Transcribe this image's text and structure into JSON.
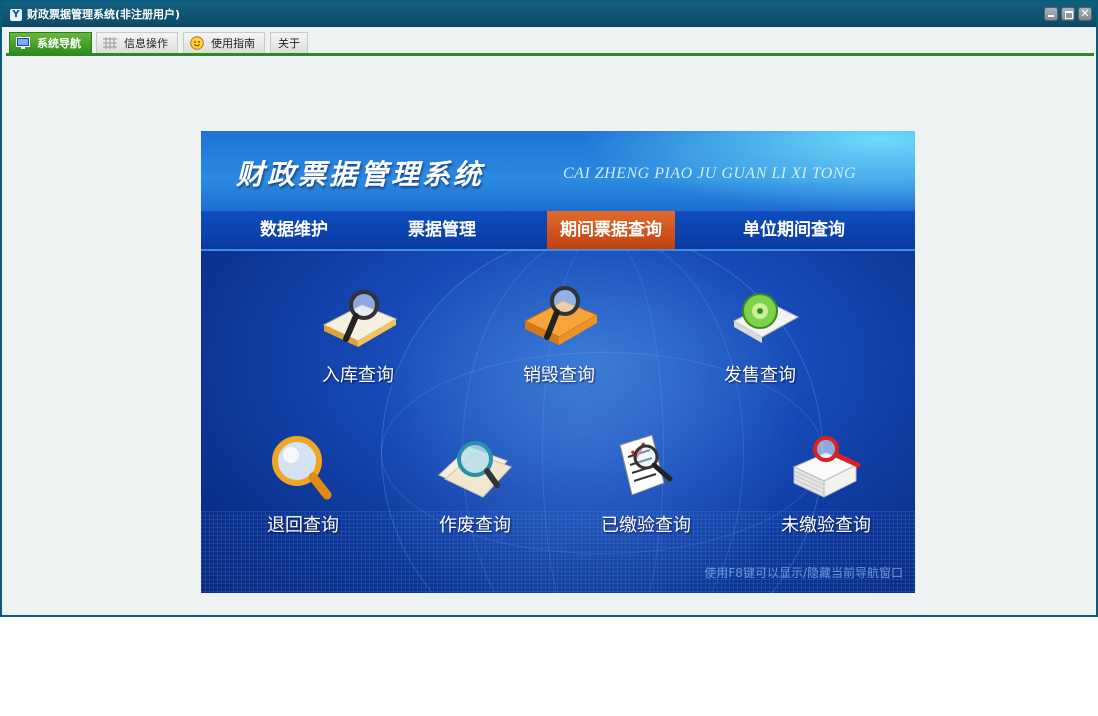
{
  "window": {
    "title": "财政票据管理系统(非注册用户)",
    "app_icon_glyph": "Y"
  },
  "tabs": [
    {
      "label": "系统导航",
      "icon": "monitor-icon",
      "active": true
    },
    {
      "label": "信息操作",
      "icon": "grid-icon",
      "active": false
    },
    {
      "label": "使用指南",
      "icon": "smiley-icon",
      "active": false
    },
    {
      "label": "关于",
      "icon": "",
      "active": false
    }
  ],
  "banner": {
    "title": "财政票据管理系统",
    "pinyin": "CAI ZHENG PIAO JU GUAN LI XI TONG",
    "nav": [
      {
        "label": "数据维护",
        "active": false
      },
      {
        "label": "票据管理",
        "active": false
      },
      {
        "label": "期间票据查询",
        "active": true
      },
      {
        "label": "单位期间查询",
        "active": false
      }
    ],
    "row1": [
      {
        "label": "入库查询",
        "icon": "folder-magnifier-icon"
      },
      {
        "label": "销毁查询",
        "icon": "orange-folder-magnifier-icon"
      },
      {
        "label": "发售查询",
        "icon": "green-disc-document-icon"
      }
    ],
    "row2": [
      {
        "label": "退回查询",
        "icon": "magnifier-icon"
      },
      {
        "label": "作废查询",
        "icon": "papers-magnifier-icon"
      },
      {
        "label": "已缴验查询",
        "icon": "checklist-magnifier-icon"
      },
      {
        "label": "未缴验查询",
        "icon": "paper-stack-magnifier-icon"
      }
    ],
    "hint": "使用F8键可以显示/隐藏当前导航窗口"
  },
  "colors": {
    "accent_green": "#2c8a22",
    "nav_active": "#d4561c",
    "banner_blue": "#1649b6"
  }
}
